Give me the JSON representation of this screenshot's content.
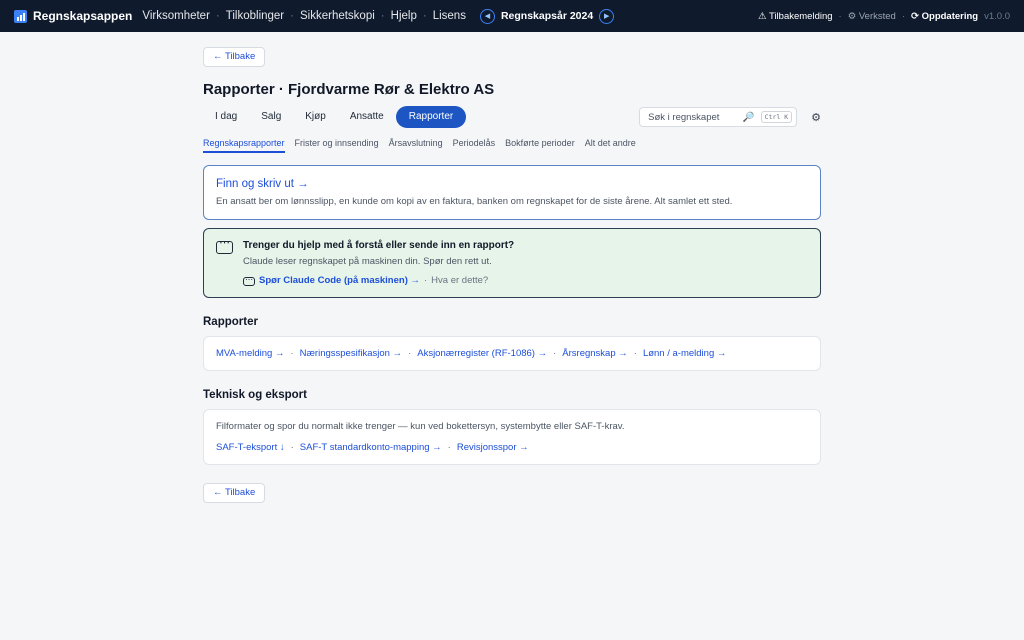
{
  "topbar": {
    "brand": "Regnskapsappen",
    "nav": [
      "Virksomheter",
      "Tilkoblinger",
      "Sikkerhetskopi",
      "Hjelp",
      "Lisens"
    ],
    "year": "Regnskapsår 2024",
    "feedback": "Tilbakemelding",
    "workshop": "Verksted",
    "update": "Oppdatering",
    "version": "v1.0.0"
  },
  "back_label": "← Tilbake",
  "page_title": "Rapporter · Fjordvarme Rør & Elektro AS",
  "tabs": [
    "I dag",
    "Salg",
    "Kjøp",
    "Ansatte",
    "Rapporter"
  ],
  "search": {
    "placeholder": "Søk i regnskapet",
    "shortcut": "Ctrl K"
  },
  "subtabs": [
    "Regnskapsrapporter",
    "Frister og innsending",
    "Årsavslutning",
    "Periodelås",
    "Bokførte perioder",
    "Alt det andre"
  ],
  "find_card": {
    "title": "Finn og skriv ut →",
    "text": "En ansatt ber om lønnsslipp, en kunde om kopi av en faktura, banken om regnskapet for de siste årene. Alt samlet ett sted."
  },
  "help_card": {
    "title": "Trenger du hjelp med å forstå eller sende inn en rapport?",
    "text": "Claude leser regnskapet på maskinen din. Spør den rett ut.",
    "link": "Spør Claude Code (på maskinen) →",
    "what": "Hva er dette?"
  },
  "reports": {
    "title": "Rapporter",
    "links": [
      "MVA-melding →",
      "Næringsspesifikasjon →",
      "Aksjonærregister (RF-1086) →",
      "Årsregnskap →",
      "Lønn / a-melding →"
    ]
  },
  "technical": {
    "title": "Teknisk og eksport",
    "text": "Filformater og spor du normalt ikke trenger — kun ved bokettersyn, systembytte eller SAF-T-krav.",
    "links": [
      "SAF-T-eksport ↓",
      "SAF-T standardkonto-mapping →",
      "Revisjonsspor →"
    ]
  },
  "colors": {
    "topbar": "#0f1b2d",
    "accent": "#1d56c2",
    "help_bg": "#e6f4ea"
  }
}
